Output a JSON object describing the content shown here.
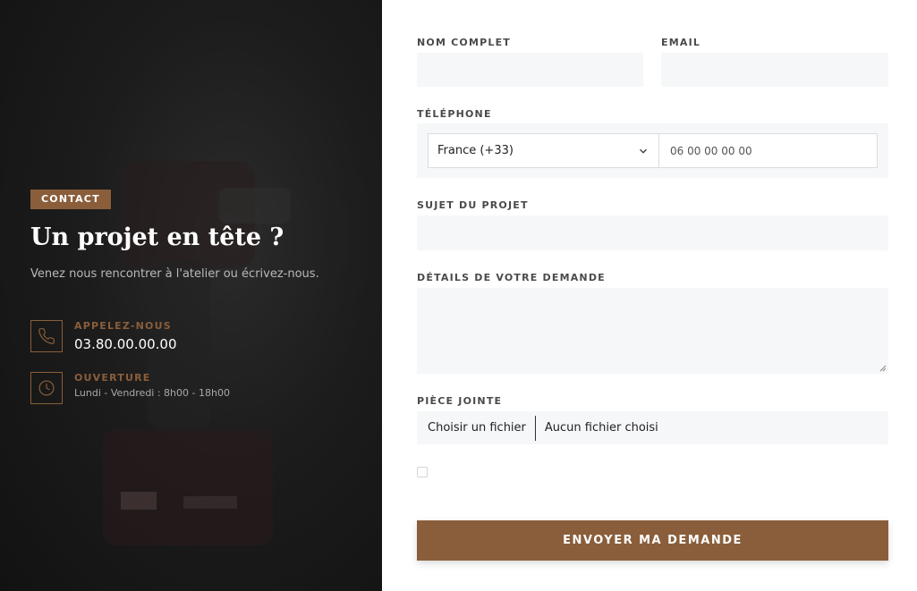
{
  "colors": {
    "accent": "#8a5e3b",
    "panel_bg": "#1c1c1c",
    "field_bg": "#f6f7f9"
  },
  "left_panel": {
    "badge": "CONTACT",
    "title": "Un projet en tête ?",
    "subtitle": "Venez nous rencontrer à l'atelier ou écrivez-nous.",
    "call": {
      "icon": "phone-icon",
      "label": "APPELEZ-NOUS",
      "value": "03.80.00.00.00"
    },
    "hours": {
      "icon": "clock-icon",
      "label": "OUVERTURE",
      "value": "Lundi - Vendredi : 8h00 - 18h00"
    }
  },
  "form": {
    "full_name_label": "NOM COMPLET",
    "email_label": "EMAIL",
    "phone_label": "TÉLÉPHONE",
    "country_selected": "France (+33)",
    "phone_placeholder": "06 00 00 00 00",
    "subject_label": "SUJET DU PROJET",
    "details_label": "DÉTAILS DE VOTRE DEMANDE",
    "attachment_label": "PIÈCE JOINTE",
    "file_button": "Choisir un fichier",
    "file_status": "Aucun fichier choisi",
    "submit_label": "ENVOYER MA DEMANDE"
  }
}
